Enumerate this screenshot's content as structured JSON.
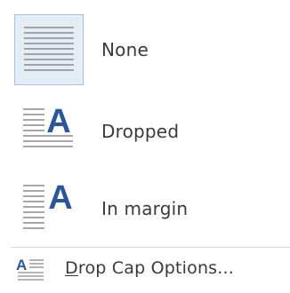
{
  "menu": {
    "items": [
      {
        "label": "None",
        "icon": "drop-cap-none-icon",
        "selected": true
      },
      {
        "label": "Dropped",
        "icon": "drop-cap-dropped-icon",
        "selected": false
      },
      {
        "label": "In margin",
        "icon": "drop-cap-in-margin-icon",
        "selected": false
      }
    ],
    "options": {
      "accel_letter": "D",
      "label_rest": "rop Cap Options...",
      "icon": "drop-cap-options-icon"
    }
  },
  "colors": {
    "accent": "#2b5797",
    "selected_bg": "#e4ecf6",
    "selected_border": "#a9c2e0",
    "text": "#3a3a3a",
    "line": "#8a8a8a"
  },
  "glyph": "A"
}
